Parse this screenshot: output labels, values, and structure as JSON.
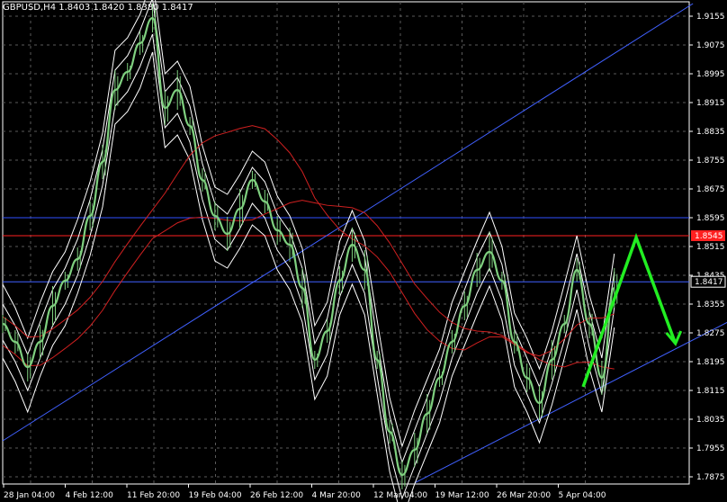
{
  "header": {
    "symbol_line": "GBPUSD,H4  1.8403 1.8420 1.8380 1.8417"
  },
  "chart_data": {
    "type": "line",
    "title": "GBPUSD,H4  1.8403 1.8420 1.8380 1.8417",
    "y_ticks": [
      "1.9155",
      "1.9075",
      "1.8995",
      "1.8915",
      "1.8835",
      "1.8755",
      "1.8675",
      "1.8595",
      "1.8515",
      "1.8435",
      "1.8355",
      "1.8275",
      "1.8195",
      "1.8115",
      "1.8035",
      "1.7955",
      "1.7875"
    ],
    "x_ticks": [
      "28 Jan 04:00",
      "4 Feb 12:00",
      "11 Feb 20:00",
      "19 Feb 04:00",
      "26 Feb 12:00",
      "4 Mar 20:00",
      "12 Mar 04:00",
      "19 Mar 12:00",
      "26 Mar 20:00",
      "5 Apr 04:00"
    ],
    "ylim": [
      1.7855,
      1.9195
    ],
    "grid": true,
    "price_labels": [
      {
        "name": "red-horizontal",
        "value": 1.8545,
        "text": "1.8545",
        "color": "#ff2020"
      },
      {
        "name": "current-price",
        "value": 1.8417,
        "text": "1.8417",
        "color": "#ffffff"
      }
    ],
    "horizontal_lines": [
      {
        "name": "blue-horizontal",
        "value": 1.8595,
        "color": "#3050ff"
      },
      {
        "name": "red-horizontal",
        "value": 1.8545,
        "color": "#ff2020"
      },
      {
        "name": "current-price-line",
        "value": 1.8417,
        "color": "#4060ff"
      }
    ],
    "trendlines": [
      {
        "name": "rising-channel-top",
        "x_start": 0.0,
        "y_start": 1.7975,
        "x_end": 110.6,
        "y_end": 1.919,
        "color": "#4060ff"
      },
      {
        "name": "rising-channel-bottom",
        "x_start": 66.0,
        "y_start": 1.7858,
        "x_end": 122.0,
        "y_end": 1.8357,
        "color": "#4060ff"
      }
    ],
    "series": [
      {
        "name": "price",
        "color": "#7fd07f",
        "x": [
          0,
          2,
          4,
          6,
          8,
          10,
          12,
          14,
          16,
          18,
          20,
          22,
          24,
          26,
          28,
          30,
          32,
          34,
          36,
          38,
          40,
          42,
          44,
          46,
          48,
          50,
          52,
          54,
          56,
          58,
          60,
          62,
          64,
          66,
          68,
          70,
          72,
          74,
          76,
          78,
          80,
          82,
          84,
          86,
          88,
          90,
          92,
          94,
          96,
          98
        ],
        "values": [
          1.83,
          1.825,
          1.818,
          1.825,
          1.835,
          1.842,
          1.848,
          1.86,
          1.875,
          1.895,
          1.9,
          1.908,
          1.915,
          1.89,
          1.895,
          1.885,
          1.87,
          1.86,
          1.855,
          1.862,
          1.87,
          1.864,
          1.856,
          1.852,
          1.84,
          1.82,
          1.828,
          1.842,
          1.852,
          1.845,
          1.82,
          1.8,
          1.788,
          1.795,
          1.805,
          1.815,
          1.825,
          1.835,
          1.845,
          1.85,
          1.842,
          1.825,
          1.815,
          1.808,
          1.82,
          1.83,
          1.845,
          1.83,
          1.815,
          1.84
        ]
      }
    ],
    "projection": {
      "color": "#22ee22",
      "x": [
        93.0,
        101.5,
        107.8
      ],
      "values": [
        1.8125,
        1.854,
        1.8245
      ]
    }
  }
}
